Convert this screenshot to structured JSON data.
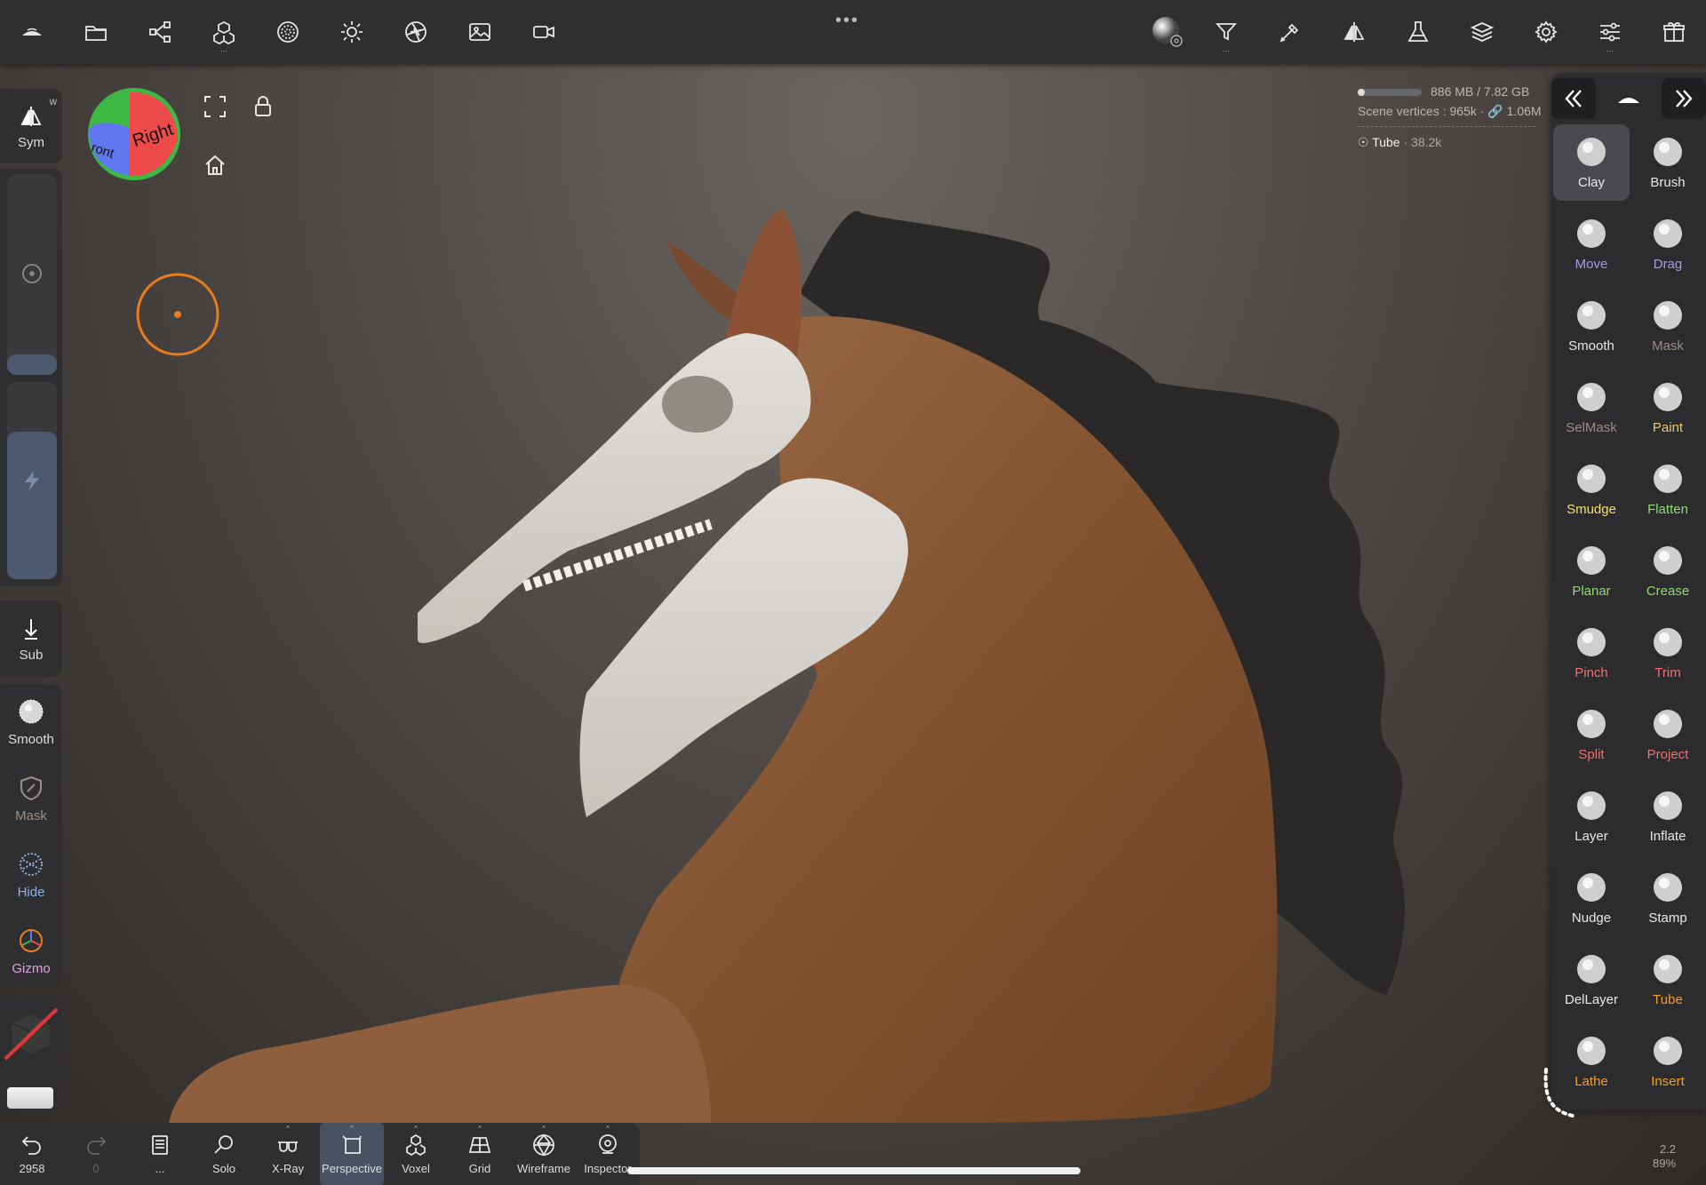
{
  "top_toolbar": {
    "left_icons": [
      "nomad-logo-icon",
      "folder-icon",
      "scene-graph-icon",
      "topology-icon",
      "material-sphere-icon",
      "light-icon",
      "camera-aperture-icon",
      "background-image-icon",
      "video-camera-icon"
    ],
    "right_icons": [
      "matcap-sphere-icon",
      "filter-icon",
      "stroke-icon",
      "symmetry-icon",
      "flask-icon",
      "layers-icon",
      "settings-icon",
      "sliders-icon",
      "gift-icon"
    ]
  },
  "left_panel": {
    "sym": {
      "label": "Sym",
      "badge": "W"
    },
    "sub": {
      "label": "Sub"
    },
    "tools": [
      {
        "label": "Smooth",
        "color": "#ffffff"
      },
      {
        "label": "Mask",
        "color": "#9a8f86"
      },
      {
        "label": "Hide",
        "color": "#8fb2e8"
      },
      {
        "label": "Gizmo",
        "color": "#e0a0e0"
      }
    ],
    "radius_slider_level": 0.1,
    "intensity_slider_level": 0.75
  },
  "view_cube": {
    "right_label": "Right",
    "front_label": "ront"
  },
  "scene_info": {
    "memory": "886 MB / 7.82 GB",
    "memory_level": 0.11,
    "vertices_label": "Scene vertices :",
    "vertices_value": "965k",
    "linked_value": "1.06M",
    "object_name": "Tube",
    "object_count": "· 38.2k"
  },
  "right_panel": {
    "tools": [
      {
        "label": "Clay",
        "color": "#e8e8e8",
        "active": true
      },
      {
        "label": "Brush",
        "color": "#e8e8e8"
      },
      {
        "label": "Move",
        "color": "#a39ce6"
      },
      {
        "label": "Drag",
        "color": "#a39ce6"
      },
      {
        "label": "Smooth",
        "color": "#e8e8e8"
      },
      {
        "label": "Mask",
        "color": "#9a8f86"
      },
      {
        "label": "SelMask",
        "color": "#9a8f86"
      },
      {
        "label": "Paint",
        "color": "#f0c870"
      },
      {
        "label": "Smudge",
        "color": "#f0e070"
      },
      {
        "label": "Flatten",
        "color": "#8fdc70"
      },
      {
        "label": "Planar",
        "color": "#8fdc70"
      },
      {
        "label": "Crease",
        "color": "#8fdc70"
      },
      {
        "label": "Pinch",
        "color": "#f07070"
      },
      {
        "label": "Trim",
        "color": "#f07070"
      },
      {
        "label": "Split",
        "color": "#f07070"
      },
      {
        "label": "Project",
        "color": "#f07070"
      },
      {
        "label": "Layer",
        "color": "#e8e8e8"
      },
      {
        "label": "Inflate",
        "color": "#e8e8e8"
      },
      {
        "label": "Nudge",
        "color": "#e8e8e8"
      },
      {
        "label": "Stamp",
        "color": "#e8e8e8"
      },
      {
        "label": "DelLayer",
        "color": "#e8e8e8"
      },
      {
        "label": "Tube",
        "color": "#f0a030"
      },
      {
        "label": "Lathe",
        "color": "#f0a030"
      },
      {
        "label": "Insert",
        "color": "#f0a030"
      }
    ]
  },
  "bottom_bar": {
    "undo_count": "2958",
    "redo_count": "0",
    "more": "...",
    "items": [
      {
        "label": "Solo"
      },
      {
        "label": "X-Ray"
      },
      {
        "label": "Perspective",
        "active": true
      },
      {
        "label": "Voxel"
      },
      {
        "label": "Grid"
      },
      {
        "label": "Wireframe"
      },
      {
        "label": "Inspector"
      }
    ]
  },
  "zoom": {
    "value": "2.2",
    "percent": "89%"
  },
  "colors": {
    "skull": "#d8d4cf",
    "horse": "#8a5838",
    "mane": "#2a2828",
    "accent": "#e87c1e"
  }
}
